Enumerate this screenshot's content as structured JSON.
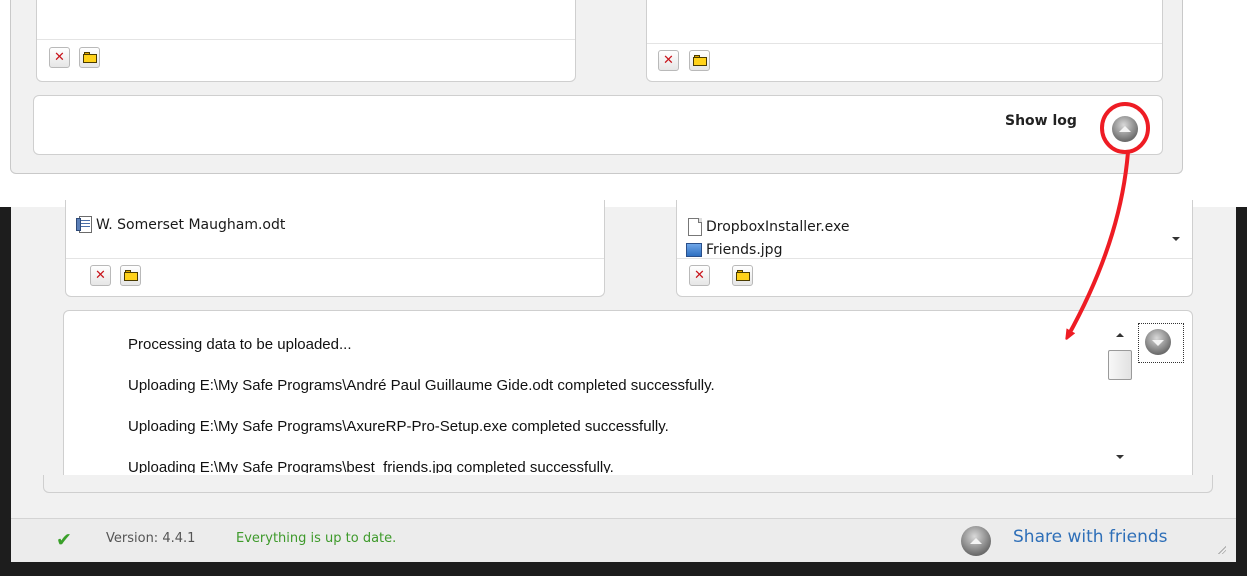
{
  "top": {
    "show_log_label": "Show log"
  },
  "bottom": {
    "left_files": [
      "W. Somerset Maugham.odt"
    ],
    "right_files": [
      "DropboxInstaller.exe",
      "Friends.jpg"
    ],
    "log_lines": [
      "Processing data to be uploaded...",
      "Uploading E:\\My Safe Programs\\André Paul Guillaume Gide.odt completed successfully.",
      "Uploading E:\\My Safe Programs\\AxureRP-Pro-Setup.exe completed successfully.",
      "Uploading E:\\My Safe Programs\\best_friends.jpg completed successfully."
    ]
  },
  "statusbar": {
    "version_label": "Version:",
    "version_number": "4.4.1",
    "status_text": "Everything is up to date.",
    "share_label": "Share with friends"
  },
  "icons": {
    "remove": "close-x-icon",
    "folder": "folder-icon",
    "toggle_up": "chevron-up-circle-icon",
    "toggle_down": "chevron-down-circle-icon",
    "share": "chevron-up-circle-icon",
    "status_ok": "checkmark-icon"
  },
  "colors": {
    "annotation_red": "#ee1c24",
    "status_green": "#3e9a2b",
    "link_blue": "#2e6fb8",
    "remove_red": "#c8141b",
    "folder_yellow": "#ffd21a"
  }
}
